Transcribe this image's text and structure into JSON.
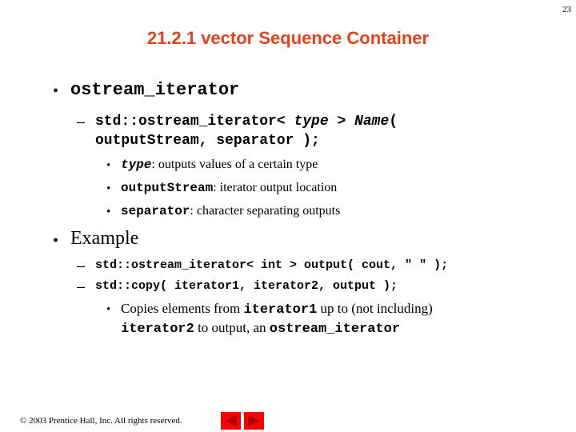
{
  "slide": {
    "page_number": "23",
    "title": "21.2.1 vector Sequence Container"
  },
  "content": {
    "bullet_ostream": {
      "mark": "•",
      "text": "ostream_iterator"
    },
    "syntax": {
      "dash": "–",
      "line1_prefix": "std::ostream_iterator< ",
      "line1_type": "type",
      "line1_mid": " > ",
      "line1_name": "Name",
      "line1_suffix": "(",
      "line2": "outputStream, separator );"
    },
    "params": [
      {
        "mark": "•",
        "code": "type",
        "text": ": outputs values of a certain type"
      },
      {
        "mark": "•",
        "code": "outputStream",
        "text": ": iterator output location"
      },
      {
        "mark": "•",
        "code": "separator",
        "text": ": character separating outputs"
      }
    ],
    "bullet_example": {
      "mark": "•",
      "text": "Example"
    },
    "example_lines": [
      {
        "dash": "–",
        "code": "std::ostream_iterator< int > output( cout, \" \" );"
      },
      {
        "dash": "–",
        "code": "std::copy( iterator1, iterator2, output );"
      }
    ],
    "copy_note": {
      "mark": "•",
      "part1": "Copies elements from ",
      "code1": "iterator1",
      "part2": " up to (not including)",
      "code2": "iterator2",
      "part3": " to output, an ",
      "code3": "ostream_iterator"
    }
  },
  "footer": {
    "copyright": "© 2003 Prentice Hall, Inc.  All rights reserved.",
    "nav_prev_icon": "triangle-left",
    "nav_next_icon": "triangle-right"
  },
  "colors": {
    "title": "#e8401c",
    "nav_button": "#ff0000",
    "nav_arrow": "#b00000"
  }
}
